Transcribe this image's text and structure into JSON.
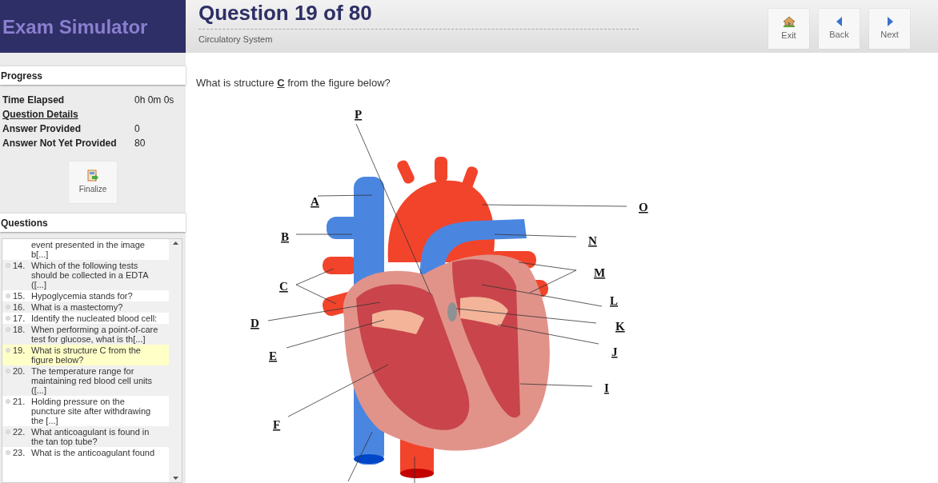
{
  "app": {
    "title": "Exam Simulator"
  },
  "header": {
    "title": "Question 19 of 80",
    "subtitle": "Circulatory System",
    "buttons": [
      {
        "kind": "exit",
        "label": "Exit"
      },
      {
        "kind": "back",
        "label": "Back"
      },
      {
        "kind": "next",
        "label": "Next"
      }
    ]
  },
  "progress": {
    "title": "Progress",
    "stats": [
      {
        "kind": "stat",
        "label": "Time Elapsed",
        "value": "0h 0m 0s"
      },
      {
        "kind": "link",
        "label": "Question Details"
      },
      {
        "kind": "stat",
        "label": "Answer Provided",
        "value": "0"
      },
      {
        "kind": "stat",
        "label": "Answer Not Yet Provided",
        "value": "80"
      }
    ],
    "finalize": "Finalize"
  },
  "questions": {
    "title": "Questions",
    "items": [
      {
        "text": "event presented in the image b[...]",
        "selected": false
      },
      {
        "number": "14.",
        "text": "Which of the following tests should be collected in a EDTA ([...]",
        "selected": false
      },
      {
        "number": "15.",
        "text": "Hypoglycemia stands for?",
        "selected": false
      },
      {
        "number": "16.",
        "text": "What is a mastectomy?",
        "selected": false
      },
      {
        "number": "17.",
        "text": "Identify the nucleated blood cell:",
        "selected": false
      },
      {
        "number": "18.",
        "text": "When performing a point-of-care test for glucose, what is th[...]",
        "selected": false
      },
      {
        "number": "19.",
        "text": "What is structure C from the figure below?",
        "selected": true
      },
      {
        "number": "20.",
        "text": "The temperature range for maintaining red blood cell units ([...]",
        "selected": false
      },
      {
        "number": "21.",
        "text": "Holding pressure on the puncture site after withdrawing the [...]",
        "selected": false
      },
      {
        "number": "22.",
        "text": "What anticoagulant is found in the tan top tube?",
        "selected": false
      },
      {
        "number": "23.",
        "text": "What is the anticoagulant found",
        "selected": false
      }
    ]
  },
  "question": {
    "prompt": "What is structure **C** from the figure below?",
    "figure": {
      "labels": [
        "P",
        "A",
        "O",
        "B",
        "N",
        "M",
        "C",
        "L",
        "D",
        "K",
        "J",
        "E",
        "I",
        "F"
      ]
    }
  }
}
